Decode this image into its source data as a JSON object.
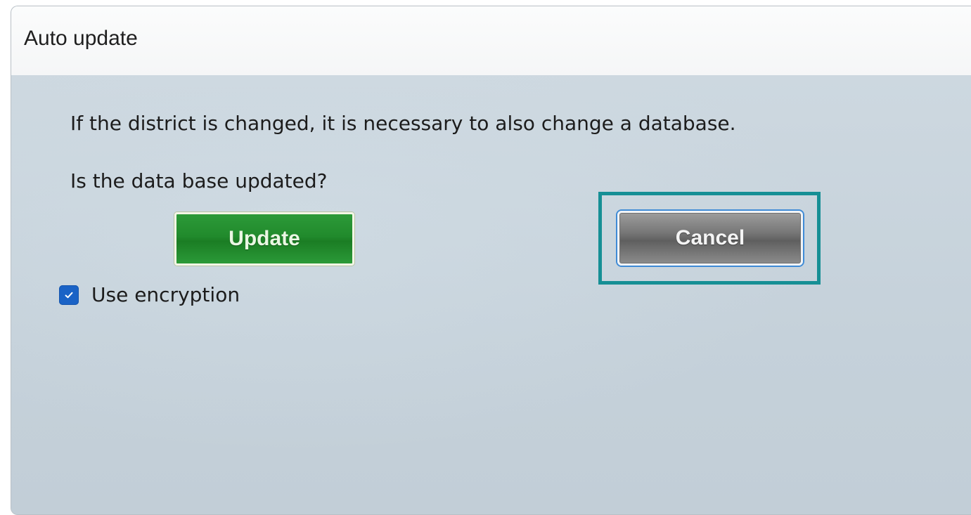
{
  "dialog": {
    "title": "Auto update",
    "message_line1": "If the district is changed, it is necessary to also change a database.",
    "message_line2": "Is the data base updated?",
    "update_label": "Update",
    "cancel_label": "Cancel",
    "encryption_label": "Use encryption",
    "encryption_checked": true
  },
  "colors": {
    "update_button": "#218a2c",
    "cancel_button": "#767676",
    "checkbox": "#1a63c6",
    "focus_highlight": "#168f95",
    "background": "#c7d2db"
  },
  "icons": {
    "checkbox_mark": "checkmark-icon"
  }
}
